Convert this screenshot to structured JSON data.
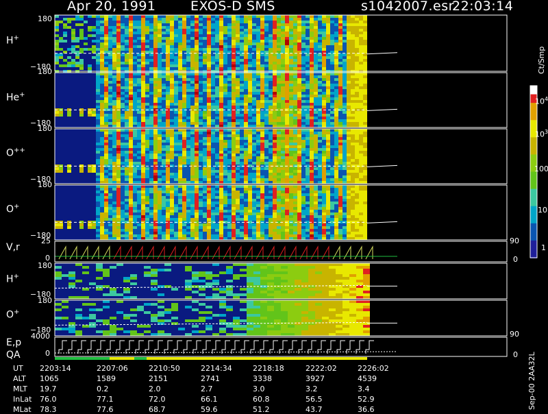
{
  "header": {
    "date": "Apr 20, 1991",
    "instrument": "EXOS-D SMS",
    "file": "s1042007.esr",
    "time": "22:03:14"
  },
  "panels": {
    "h_plus": {
      "label": "H",
      "sup": "+",
      "top": "180",
      "bottom": "−180"
    },
    "he_plus": {
      "label": "He",
      "sup": "+",
      "top": "180",
      "bottom": "−180"
    },
    "o_pp": {
      "label": "O",
      "sup": "++",
      "top": "180",
      "bottom": "−180"
    },
    "o_plus": {
      "label": "O",
      "sup": "+",
      "top": "180",
      "bottom": "−180"
    },
    "vr": {
      "label": "V,r",
      "top": "25",
      "bottom": "0",
      "right_top": "90",
      "right_bottom": "0"
    },
    "h_plus2": {
      "label": "H",
      "sup": "+",
      "top": "180",
      "bottom": "−180"
    },
    "o_plus2": {
      "label": "O",
      "sup": "+",
      "top": "180",
      "bottom": "−180"
    },
    "ep": {
      "label1": "E,p",
      "label2": "QA",
      "top": "4000",
      "bottom": "0",
      "right_top": "90",
      "right_bottom": "0"
    }
  },
  "colorbar": {
    "unit": "Ct/Smp",
    "ticks": [
      "1",
      "10",
      "100",
      "10",
      "3",
      "10",
      "4"
    ]
  },
  "footer_id": "Sep-00 2AA32L",
  "ephemeris": {
    "rows": [
      {
        "name": "UT",
        "values": [
          "2203:14",
          "2207:06",
          "2210:50",
          "2214:34",
          "2218:18",
          "2222:02",
          "2226:02"
        ]
      },
      {
        "name": "ALT",
        "values": [
          "1065",
          "1589",
          "2151",
          "2741",
          "3338",
          "3927",
          "4539"
        ]
      },
      {
        "name": "MLT",
        "values": [
          "19.7",
          "0.2",
          "2.0",
          "2.7",
          "3.0",
          "3.2",
          "3.4"
        ]
      },
      {
        "name": "InLat",
        "values": [
          "76.0",
          "77.1",
          "72.0",
          "66.1",
          "60.8",
          "56.5",
          "52.9"
        ]
      },
      {
        "name": "MLat",
        "values": [
          "78.3",
          "77.6",
          "68.7",
          "59.6",
          "51.2",
          "43.7",
          "36.6"
        ]
      }
    ]
  },
  "colors": {
    "background": "#000000",
    "low": "#0a1a80",
    "mid": "#60c020",
    "high": "#e01010"
  },
  "chart_data": {
    "type": "heatmap",
    "title": "Apr 20, 1991   EXOS-D SMS",
    "x_axis": "UT",
    "xlim": [
      "2203:14",
      "2226:02"
    ],
    "color_scale": "log",
    "color_range": [
      1,
      10000
    ],
    "color_unit": "Ct/Smp",
    "series": [
      {
        "name": "H+",
        "ylim": [
          -180,
          180
        ]
      },
      {
        "name": "He+",
        "ylim": [
          -180,
          180
        ]
      },
      {
        "name": "O++",
        "ylim": [
          -180,
          180
        ]
      },
      {
        "name": "O+",
        "ylim": [
          -180,
          180
        ]
      },
      {
        "name": "V,r",
        "ylim": [
          0,
          25
        ]
      },
      {
        "name": "H+",
        "ylim": [
          -180,
          180
        ]
      },
      {
        "name": "O+",
        "ylim": [
          -180,
          180
        ]
      },
      {
        "name": "E,p",
        "ylim": [
          0,
          4000
        ]
      }
    ]
  }
}
